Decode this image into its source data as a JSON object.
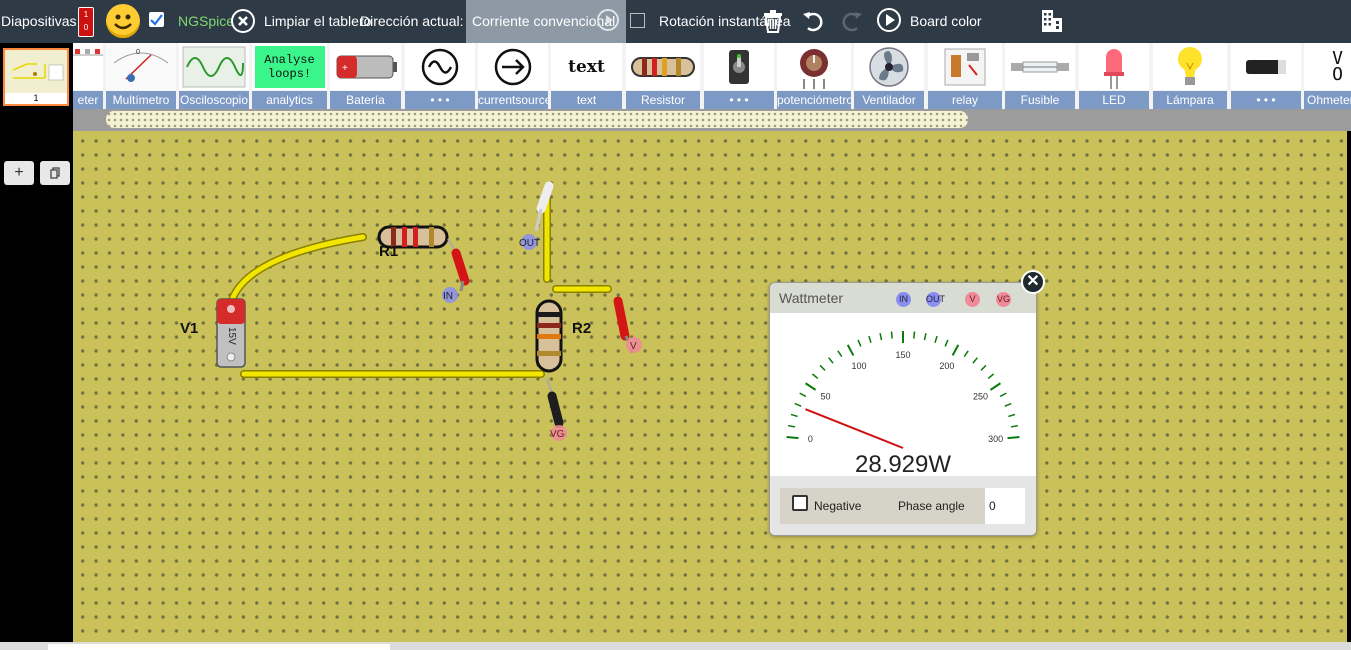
{
  "topbar": {
    "slides_label": "Diapositivas",
    "ngspice_label": "NGSpice",
    "ngspice_checked": true,
    "clear_label": "Limpiar el tablero",
    "direction_label": "Dirección actual:",
    "direction_value": "Corriente convencional",
    "rotation_label": "Rotación instantánea",
    "board_color_label": "Board color",
    "icons": [
      "power-switch-icon",
      "smiley-icon",
      "close-circle-icon",
      "play-circle-icon",
      "trash-icon",
      "undo-icon",
      "redo-icon",
      "play-icon",
      "building-icon"
    ]
  },
  "sidebar": {
    "slide_number": "1",
    "add_label": "+",
    "copy_icon": "copy-icon"
  },
  "palette": [
    {
      "label": "eter",
      "icon": "ammeter-icon"
    },
    {
      "label": "Multímetro",
      "icon": "multimeter-icon"
    },
    {
      "label": "Osciloscopio",
      "icon": "oscilloscope-icon"
    },
    {
      "label": "analytics",
      "icon": "analyse-loops-icon",
      "tile_text": "Analyse loops!"
    },
    {
      "label": "Batería",
      "icon": "battery-icon"
    },
    {
      "label": "• • •",
      "icon": "ac-source-icon"
    },
    {
      "label": "currentsource",
      "icon": "current-source-icon"
    },
    {
      "label": "text",
      "icon": "text-icon",
      "tile_text": "text"
    },
    {
      "label": "Resistor",
      "icon": "resistor-icon"
    },
    {
      "label": "• • •",
      "icon": "switch-icon"
    },
    {
      "label": "potenciómetro",
      "icon": "potentiometer-icon"
    },
    {
      "label": "Ventilador",
      "icon": "fan-icon"
    },
    {
      "label": "relay",
      "icon": "relay-icon"
    },
    {
      "label": "Fusible",
      "icon": "fuse-icon"
    },
    {
      "label": "LED",
      "icon": "led-icon"
    },
    {
      "label": "Lámpara",
      "icon": "lamp-icon"
    },
    {
      "label": "• • •",
      "icon": "component-icon"
    },
    {
      "label": "Ohmetermeter",
      "icon": "ohmmeter-icon"
    }
  ],
  "circuit": {
    "v1_label": "V1",
    "v1_value": "15V",
    "r1_label": "R1",
    "r2_label": "R2",
    "probe_in": "IN",
    "probe_out": "OUT",
    "probe_v": "V",
    "probe_vg": "VG"
  },
  "wattmeter": {
    "title": "Wattmeter",
    "ports": [
      "IN",
      "OUT",
      "V",
      "VG"
    ],
    "scale_labels": [
      "0",
      "50",
      "100",
      "150",
      "200",
      "250",
      "300"
    ],
    "scale_max": 300,
    "reading_value": 28.929,
    "reading": "28.929W",
    "negative_label": "Negative",
    "negative_checked": false,
    "phase_label": "Phase angle",
    "phase_value": "0",
    "close_icon": "close-icon"
  },
  "colors": {
    "topbar": "#2e3a46",
    "board": "#cbc15a",
    "palette_label": "#7d99c6",
    "wire": "#f2e600",
    "needle": "#d01010",
    "tick": "#0a7a0a"
  }
}
